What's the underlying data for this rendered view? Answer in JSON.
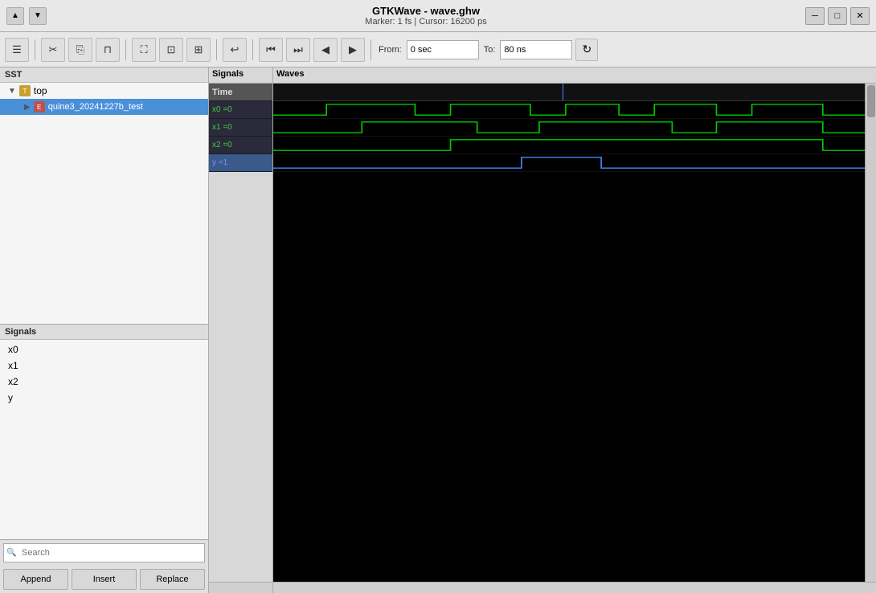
{
  "titlebar": {
    "title": "GTKWave - wave.ghw",
    "subtitle": "Marker: 1 fs  |  Cursor: 16200 ps",
    "min_label": "─",
    "max_label": "□",
    "close_label": "✕",
    "collapse_up": "▲",
    "collapse_down": "▼"
  },
  "toolbar": {
    "hamburger": "☰",
    "cut": "✂",
    "copy": "⎘",
    "paste": "⊓",
    "zoom_fit": "⛶",
    "zoom_range": "⊡",
    "zoom_cursor": "⊞",
    "undo": "↩",
    "first": "⏮",
    "last": "⏭",
    "prev": "◀",
    "next": "▶",
    "from_label": "From:",
    "from_value": "0 sec",
    "to_label": "To:",
    "to_value": "80 ns",
    "reload": "↻"
  },
  "sst": {
    "header": "SST",
    "items": [
      {
        "label": "top",
        "indent": 10,
        "type": "folder",
        "expanded": true
      },
      {
        "label": "quine3_20241227b_test",
        "indent": 30,
        "type": "entity",
        "selected": true
      }
    ]
  },
  "signals": {
    "header": "Signals",
    "items": [
      {
        "label": "x0"
      },
      {
        "label": "x1"
      },
      {
        "label": "x2"
      },
      {
        "label": "y"
      }
    ],
    "search_placeholder": "Search"
  },
  "action_buttons": [
    {
      "label": "Append"
    },
    {
      "label": "Insert"
    },
    {
      "label": "Replace"
    }
  ],
  "waves": {
    "headers": {
      "signals": "Signals",
      "waves": "Waves"
    },
    "rows": [
      {
        "name": "Time",
        "value": "",
        "selected": false,
        "is_time": true
      },
      {
        "name": "x0 =0",
        "value": "=0",
        "selected": false
      },
      {
        "name": "x1 =0",
        "value": "=0",
        "selected": false
      },
      {
        "name": "x2 =0",
        "value": "=0",
        "selected": false
      },
      {
        "name": "y =1",
        "value": "=1",
        "selected": true
      }
    ]
  }
}
